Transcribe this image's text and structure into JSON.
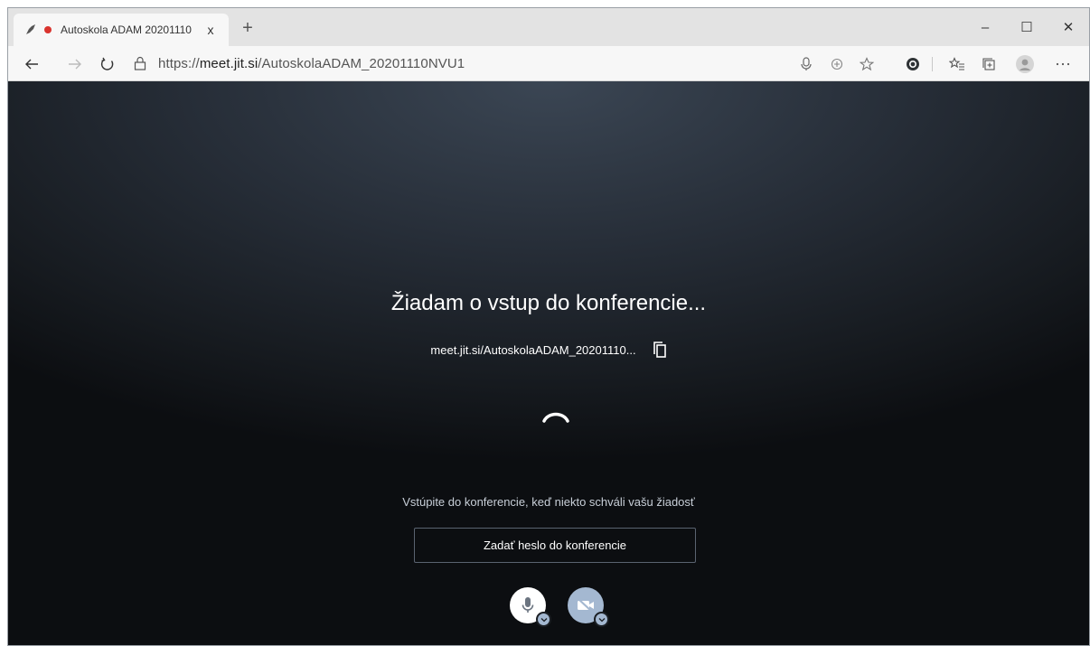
{
  "tab": {
    "title": "Autoskola ADAM 20201110",
    "close": "x",
    "new_tab": "+"
  },
  "window_controls": {
    "minimize": "–",
    "maximize": "☐",
    "close": "✕"
  },
  "address_bar": {
    "url_prefix": "https://",
    "url_host": "meet.jit.si",
    "url_path": "/AutoskolaADAM_20201110NVU1"
  },
  "page": {
    "heading": "Žiadam o vstup do konferencie...",
    "room_url": "meet.jit.si/AutoskolaADAM_20201110...",
    "info_text": "Vstúpite do konferencie, keď niekto schváli vašu žiadosť",
    "password_button": "Zadať heslo do konferencie"
  },
  "icons": {
    "favicon": "jitsi-icon",
    "recording": "recording-dot-icon",
    "back": "back-arrow-icon",
    "forward": "forward-arrow-icon",
    "refresh": "refresh-icon",
    "lock": "lock-icon",
    "microphone": "microphone-icon",
    "add": "add-circle-icon",
    "favorite": "star-icon",
    "extension": "extension-icon",
    "favorites": "favorites-icon",
    "collections": "collections-icon",
    "profile": "profile-icon",
    "more": "more-icon",
    "copy": "copy-icon",
    "spinner": "loading-spinner-icon",
    "mic_toggle": "microphone-icon",
    "camera_toggle": "camera-off-icon"
  },
  "colors": {
    "recording_red": "#d9332e",
    "media_button": "#a4b8d1",
    "mic_button": "#ffffff"
  }
}
